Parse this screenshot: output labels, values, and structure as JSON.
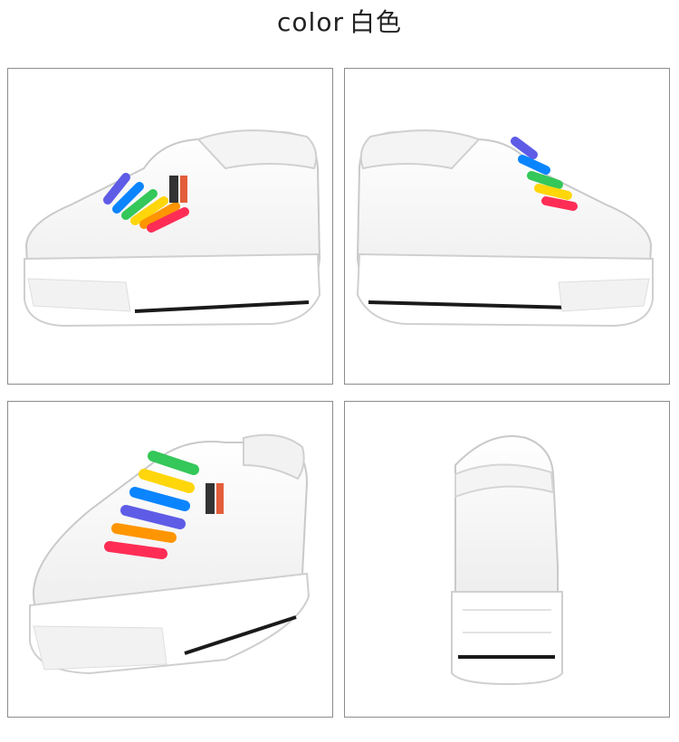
{
  "header": {
    "title_en": "color",
    "title_zh": "白色"
  },
  "views": [
    {
      "icon": "shoe-side-left-icon"
    },
    {
      "icon": "shoe-side-right-icon"
    },
    {
      "icon": "shoe-three-quarter-icon"
    },
    {
      "icon": "shoe-back-icon"
    }
  ],
  "colors": {
    "upper": "#ffffff",
    "outline": "#c9c9c9",
    "sole_stripe": "#1a1a1a",
    "laces": [
      "#ff2d55",
      "#ff9500",
      "#ffd60a",
      "#34c759",
      "#0a84ff",
      "#5e5ce6"
    ]
  }
}
